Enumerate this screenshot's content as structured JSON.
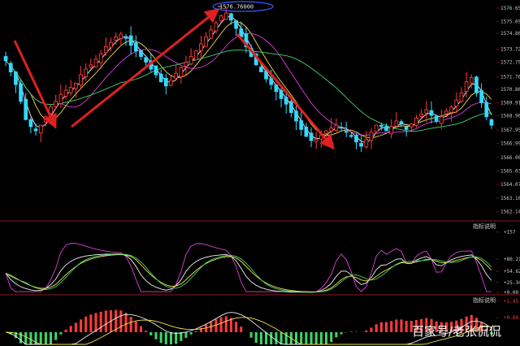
{
  "chart_data": [
    {
      "type": "candlestick",
      "panel": "price",
      "price_ticks": [
        "1576.65",
        "1575.69",
        "1574.86",
        "1573.72",
        "1572.79",
        "1571.76",
        "1570.86",
        "1569.91",
        "1568.96",
        "1567.95",
        "1566.99",
        "1566.00",
        "1565.03",
        "1564.07",
        "1563.10",
        "1562.14"
      ],
      "ylim": [
        1561.7,
        1577.0
      ],
      "peak_label": "1576.76000",
      "peak_value": 1576.76,
      "closes": [
        1572.9,
        1572.1,
        1571.2,
        1570.0,
        1568.7,
        1568.2,
        1567.9,
        1568.3,
        1568.9,
        1569.6,
        1570.0,
        1570.5,
        1570.8,
        1571.0,
        1571.3,
        1571.9,
        1572.3,
        1572.6,
        1573.0,
        1573.4,
        1573.9,
        1574.2,
        1574.6,
        1574.8,
        1574.5,
        1574.0,
        1573.6,
        1573.2,
        1572.8,
        1572.3,
        1571.9,
        1571.4,
        1571.1,
        1571.5,
        1572.0,
        1572.4,
        1572.8,
        1573.2,
        1573.6,
        1574.1,
        1574.6,
        1575.1,
        1575.6,
        1576.1,
        1576.3,
        1575.8,
        1575.2,
        1574.6,
        1573.9,
        1573.2,
        1572.6,
        1572.1,
        1571.6,
        1571.2,
        1570.7,
        1570.2,
        1569.8,
        1569.2,
        1568.6,
        1568.0,
        1567.5,
        1567.2,
        1567.3,
        1567.6,
        1567.9,
        1568.1,
        1568.3,
        1568.1,
        1567.8,
        1567.5,
        1567.1,
        1566.8,
        1567.3,
        1567.8,
        1568.3,
        1568.2,
        1567.9,
        1568.2,
        1568.6,
        1568.4,
        1568.0,
        1568.4,
        1568.8,
        1569.1,
        1569.4,
        1569.0,
        1568.6,
        1568.9,
        1569.3,
        1569.6,
        1570.1,
        1570.6,
        1571.4,
        1571.7,
        1570.6,
        1569.9,
        1568.9,
        1568.3
      ],
      "annotations": [
        {
          "kind": "arrow",
          "direction": "down"
        },
        {
          "kind": "arrow",
          "direction": "up"
        },
        {
          "kind": "arrow",
          "direction": "down"
        }
      ]
    },
    {
      "type": "line",
      "panel": "oscillator",
      "title": "指标说明",
      "ticks": [
        "+157",
        "+86.21",
        "+54.62",
        "+25.34",
        "+0.00"
      ],
      "ylim": [
        0,
        160
      ]
    },
    {
      "type": "bar",
      "panel": "macd",
      "title": "指标说明",
      "ticks": [
        "+1.45",
        "+0.68"
      ],
      "ylim": [
        -1.0,
        1.6
      ]
    }
  ],
  "watermark": "百家号/老张侃侃",
  "colors": {
    "background": "#000000",
    "up_candle": "#ff3b3b",
    "down_candle": "#35d8ff",
    "ma_white": "#f0f0f0",
    "ma_yellow": "#f2e14a",
    "ma_magenta": "#e040e0",
    "ma_green": "#3fd46a",
    "arrow": "#e02020",
    "divider": "#8b1a1a",
    "peak_ellipse": "#3a5cff"
  }
}
